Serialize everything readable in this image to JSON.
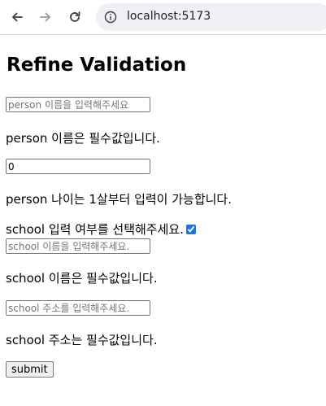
{
  "browser": {
    "url": "localhost:5173"
  },
  "page": {
    "title": "Refine Validation",
    "person_name": {
      "placeholder": "person 이름을 입력해주세요",
      "value": "",
      "error": "person 이름은 필수값입니다."
    },
    "person_age": {
      "placeholder": "",
      "value": "0",
      "error": "person 나이는 1살부터 입력이 가능합니다."
    },
    "school_toggle": {
      "label": "school 입력 여부를 선택해주세요.",
      "checked": true
    },
    "school_name": {
      "placeholder": "school 이름을 입력해주세요.",
      "value": "",
      "error": "school 이름은 필수값입니다."
    },
    "school_address": {
      "placeholder": "school 주소를 입력해주세요.",
      "value": "",
      "error": "school 주소는 필수값입니다."
    },
    "submit_label": "submit"
  }
}
